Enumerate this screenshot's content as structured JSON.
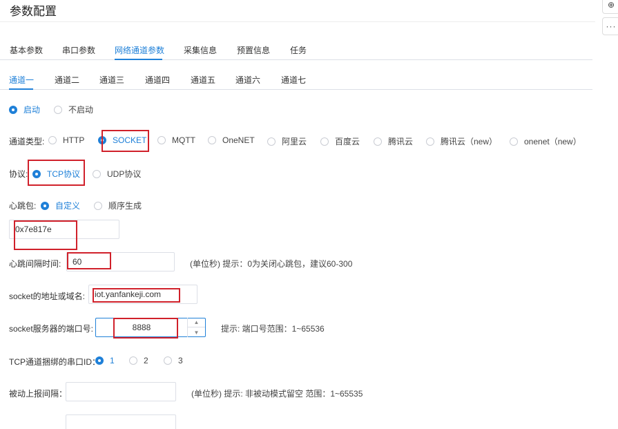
{
  "page": {
    "title": "参数配置"
  },
  "side_tools": {
    "zoom": "⊕",
    "more": "···"
  },
  "main_tabs": [
    {
      "label": "基本参数"
    },
    {
      "label": "串口参数"
    },
    {
      "label": "网络通道参数"
    },
    {
      "label": "采集信息"
    },
    {
      "label": "预置信息"
    },
    {
      "label": "任务"
    }
  ],
  "channel_tabs": [
    {
      "label": "通道一"
    },
    {
      "label": "通道二"
    },
    {
      "label": "通道三"
    },
    {
      "label": "通道四"
    },
    {
      "label": "通道五"
    },
    {
      "label": "通道六"
    },
    {
      "label": "通道七"
    }
  ],
  "enable": {
    "options": [
      {
        "label": "启动",
        "checked": true
      },
      {
        "label": "不启动",
        "checked": false
      }
    ]
  },
  "channel_type": {
    "label": "通道类型:",
    "options": [
      {
        "label": "HTTP",
        "checked": false
      },
      {
        "label": "SOCKET",
        "checked": true
      },
      {
        "label": "MQTT",
        "checked": false
      },
      {
        "label": "OneNET",
        "checked": false
      },
      {
        "label": "阿里云",
        "checked": false
      },
      {
        "label": "百度云",
        "checked": false
      },
      {
        "label": "腾讯云",
        "checked": false
      },
      {
        "label": "腾讯云（new）",
        "checked": false
      },
      {
        "label": "onenet（new）",
        "checked": false
      }
    ]
  },
  "protocol": {
    "label": "协议:",
    "options": [
      {
        "label": "TCP协议",
        "checked": true
      },
      {
        "label": "UDP协议",
        "checked": false
      }
    ]
  },
  "heartbeat": {
    "label": "心跳包:",
    "options": [
      {
        "label": "自定义",
        "checked": true
      },
      {
        "label": "顺序生成",
        "checked": false
      }
    ],
    "value": "0x7e817e"
  },
  "heartbeat_interval": {
    "label": "心跳间隔时间:",
    "value": "60",
    "hint": "(单位秒) 提示：0为关闭心跳包，建议60-300"
  },
  "socket_address": {
    "label": "socket的地址或域名:",
    "value": "iot.yanfankeji.com"
  },
  "socket_port": {
    "label": "socket服务器的端口号:",
    "value": "8888",
    "hint": "提示: 端口号范围：1~65536"
  },
  "serial_id": {
    "label": "TCP通道捆绑的串口ID：",
    "options": [
      {
        "label": "1",
        "checked": true
      },
      {
        "label": "2",
        "checked": false
      },
      {
        "label": "3",
        "checked": false
      }
    ]
  },
  "passive_report": {
    "label": "被动上报间隔：",
    "value": "",
    "hint": "(单位秒) 提示: 非被动模式留空 范围：1~65535"
  },
  "highlight_color": "#d0202a",
  "accent_color": "#1f80d8"
}
